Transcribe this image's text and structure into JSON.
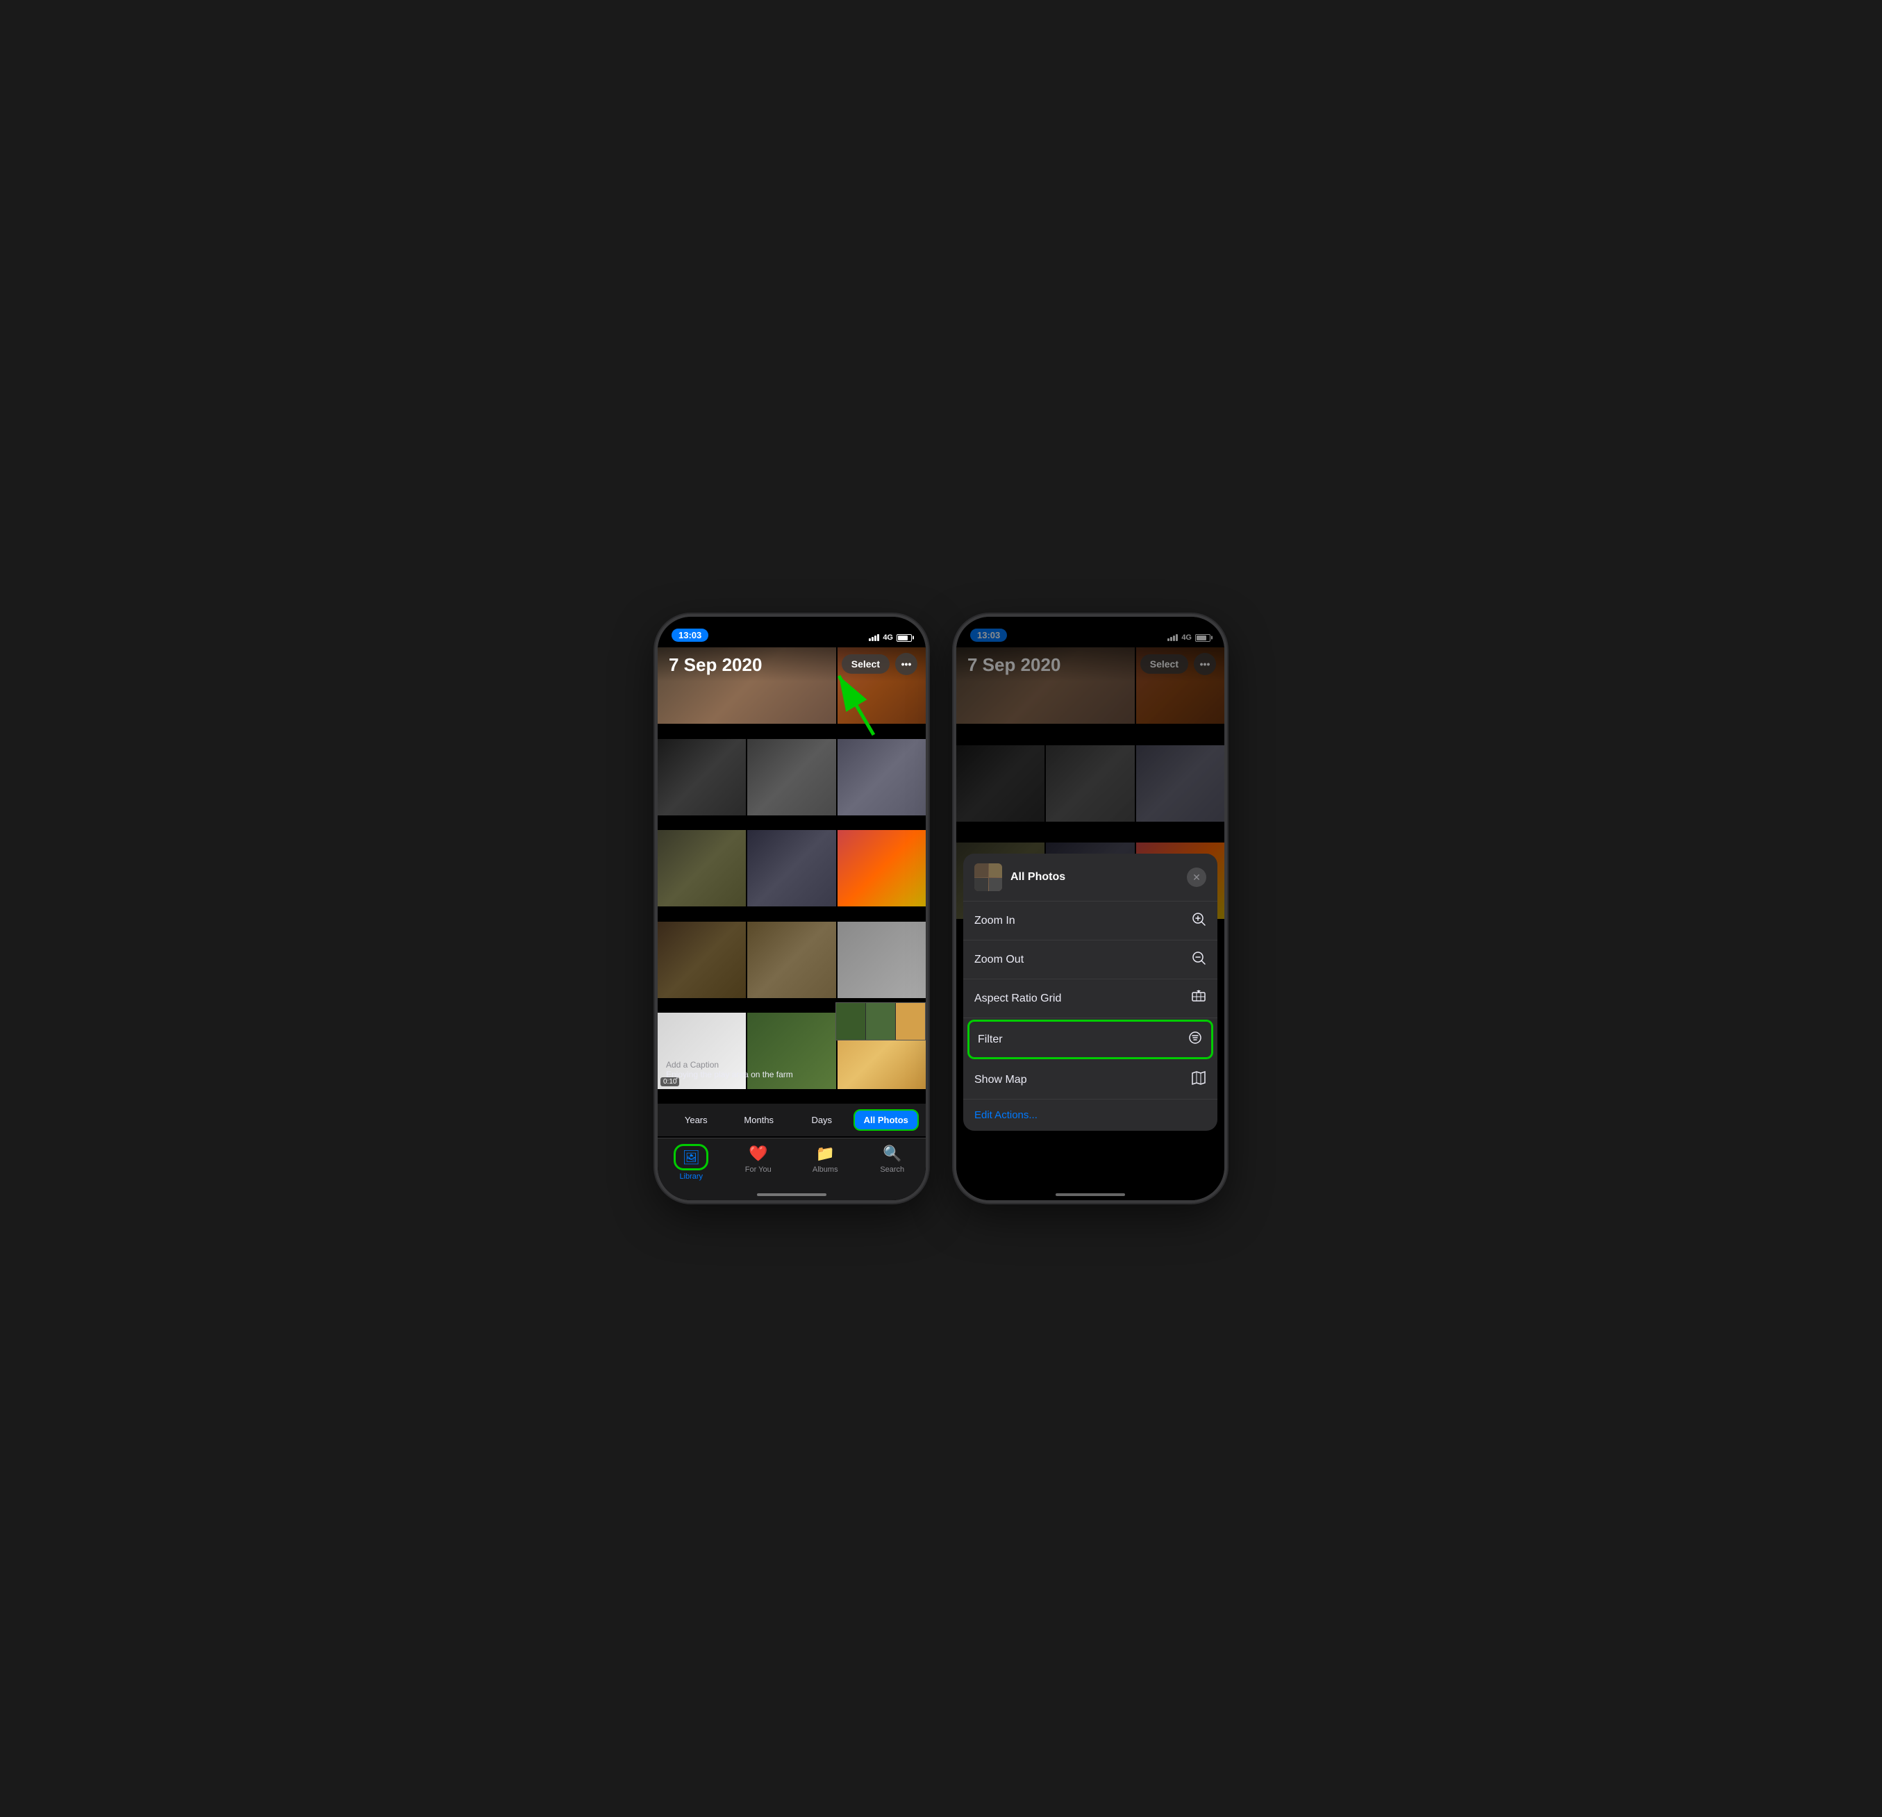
{
  "phone_left": {
    "status": {
      "time": "13:03",
      "signal": "4G",
      "battery": "full"
    },
    "date_title": "7 Sep 2020",
    "select_btn": "Select",
    "more_btn": "•••",
    "segments": [
      "Years",
      "Months",
      "Days",
      "All Photos"
    ],
    "active_segment": "All Photos",
    "tab_items": [
      {
        "label": "Library",
        "active": true
      },
      {
        "label": "For You",
        "active": false
      },
      {
        "label": "Albums",
        "active": false
      },
      {
        "label": "Search",
        "active": false
      }
    ],
    "caption_add": "Add a Caption",
    "caption_text": "Enjoying the play area on the farm",
    "video_badge": "0:10"
  },
  "phone_right": {
    "status": {
      "time": "13:03",
      "signal": "4G",
      "battery": "full"
    },
    "date_title": "7 Sep 2020",
    "select_btn": "Select",
    "more_btn": "•••",
    "context_menu": {
      "title": "All Photos",
      "close_btn": "✕",
      "items": [
        {
          "label": "Zoom In",
          "icon": "⊕"
        },
        {
          "label": "Zoom Out",
          "icon": "⊖"
        },
        {
          "label": "Aspect Ratio Grid",
          "icon": "⊟"
        },
        {
          "label": "Filter",
          "icon": "≡",
          "highlighted": true
        },
        {
          "label": "Show Map",
          "icon": "🗺"
        }
      ],
      "edit_actions": "Edit Actions..."
    }
  },
  "icons": {
    "library": "🖼",
    "for_you": "❤",
    "albums": "📁",
    "search": "🔍"
  }
}
